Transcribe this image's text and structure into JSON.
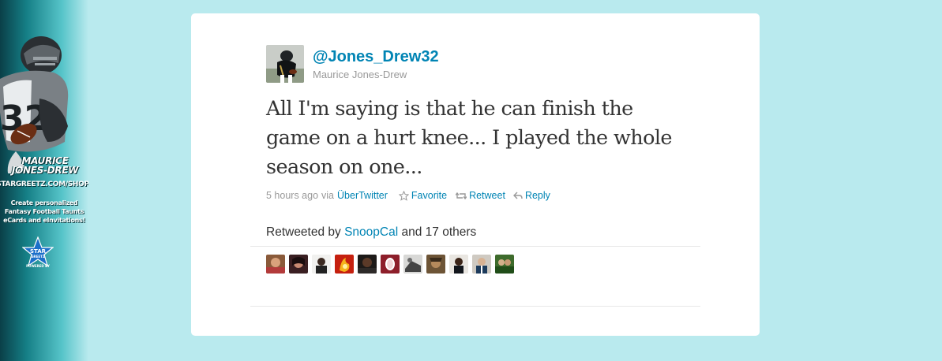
{
  "promo": {
    "player_name_line1": "MAURICE",
    "player_name_line2": "JONES-DREW",
    "url": "STARGREETZ.COM/SHOP",
    "tagline_line1": "Create personalized",
    "tagline_line2": "Fantasy Football Taunts",
    "tagline_line3": "eCards and eInvitations!",
    "logo_text_top": "STAR",
    "logo_text_bottom": "GREETZ",
    "powered_by": "POWERED BY",
    "jersey_number": "32",
    "colors": {
      "background_dark": "#0a3f48",
      "background_mid": "#157f86",
      "logo_blue": "#1b6fc9"
    }
  },
  "tweet": {
    "screen_name": "@Jones_Drew32",
    "full_name": "Maurice Jones-Drew",
    "text": "All I'm saying is that he can finish the game on a hurt knee... I played the whole season on one...",
    "timestamp": "5 hours ago",
    "via_label": "via",
    "source": "ÜberTwitter",
    "actions": {
      "favorite": "Favorite",
      "retweet": "Retweet",
      "reply": "Reply"
    },
    "retweeted_by": {
      "prefix": "Retweeted by",
      "user": "SnoopCal",
      "suffix": "and 17 others"
    },
    "retweeter_avatars": [
      "avatar-retweeter-1",
      "avatar-retweeter-2",
      "avatar-retweeter-3",
      "avatar-retweeter-4",
      "avatar-retweeter-5",
      "avatar-retweeter-6",
      "avatar-retweeter-7",
      "avatar-retweeter-8",
      "avatar-retweeter-9",
      "avatar-retweeter-10",
      "avatar-retweeter-11"
    ]
  },
  "colors": {
    "page_background": "#b9eaee",
    "link": "#0084b4",
    "text": "#333333",
    "muted": "#999999"
  }
}
